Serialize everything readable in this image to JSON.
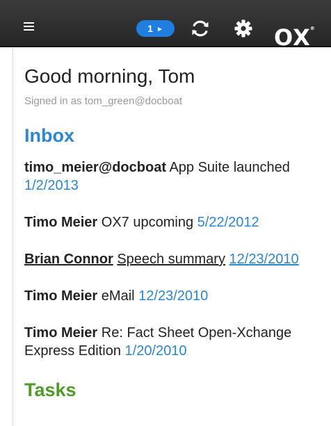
{
  "topbar": {
    "notification_count": "1",
    "notification_arrow": "►",
    "logo_text": "OX",
    "logo_mark": "®"
  },
  "icons": {
    "menu": "hamburger-menu-icon",
    "refresh": "refresh-icon",
    "settings": "gear-icon"
  },
  "greeting": {
    "title": "Good morning, Tom",
    "signed_in": "Signed in as tom_green@docboat"
  },
  "inbox": {
    "title": "Inbox",
    "items": [
      {
        "sender": "timo_meier@docboat",
        "subject": "App Suite launched",
        "date": "1/2/2013"
      },
      {
        "sender": "Timo Meier",
        "subject": "OX7 upcoming",
        "date": "5/22/2012"
      },
      {
        "sender": "Brian Connor",
        "subject": "Speech summary",
        "date": "12/23/2010"
      },
      {
        "sender": "Timo Meier",
        "subject": "eMail",
        "date": "12/23/2010"
      },
      {
        "sender": "Timo Meier",
        "subject": "Re: Fact Sheet Open-Xchange Express Edition",
        "date": "1/20/2010"
      }
    ]
  },
  "tasks": {
    "title": "Tasks"
  },
  "colors": {
    "accent_blue": "#2b86d4",
    "badge_blue": "#1f7fe0",
    "tasks_green": "#4f9b2a",
    "topbar_dark": "#2e2e2e"
  }
}
